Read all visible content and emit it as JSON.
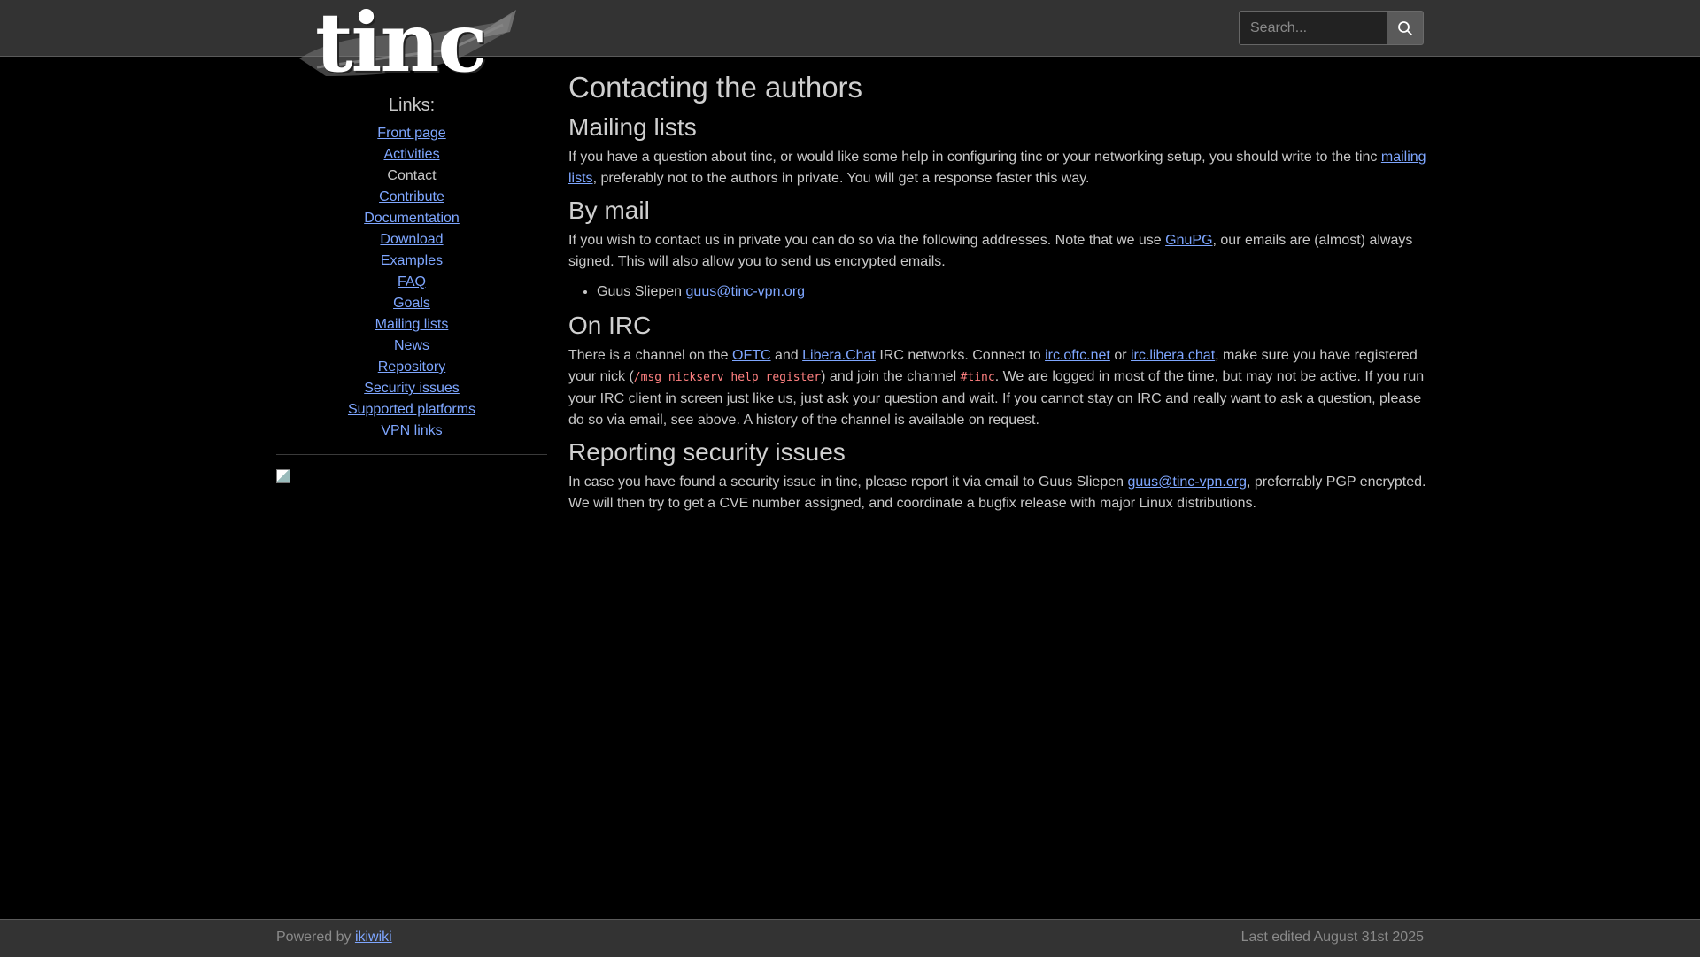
{
  "header": {
    "logo_text": "tinc",
    "search_placeholder": "Search..."
  },
  "sidebar": {
    "heading": "Links:",
    "items": [
      {
        "label": "Front page",
        "link": true
      },
      {
        "label": "Activities",
        "link": true
      },
      {
        "label": "Contact",
        "link": false
      },
      {
        "label": "Contribute",
        "link": true
      },
      {
        "label": "Documentation",
        "link": true
      },
      {
        "label": "Download",
        "link": true
      },
      {
        "label": "Examples",
        "link": true
      },
      {
        "label": "FAQ",
        "link": true
      },
      {
        "label": "Goals",
        "link": true
      },
      {
        "label": "Mailing lists",
        "link": true
      },
      {
        "label": "News",
        "link": true
      },
      {
        "label": "Repository",
        "link": true
      },
      {
        "label": "Security issues",
        "link": true
      },
      {
        "label": "Supported platforms",
        "link": true
      },
      {
        "label": "VPN links",
        "link": true
      }
    ]
  },
  "main": {
    "title": "Contacting the authors",
    "mailing": {
      "heading": "Mailing lists",
      "text1": "If you have a question about tinc, or would like some help in configuring tinc or your networking setup, you should write to the tinc ",
      "link": "mailing lists",
      "text2": ", preferably not to the authors in private. You will get a response faster this way."
    },
    "mail": {
      "heading": "By mail",
      "text1": "If you wish to contact us in private you can do so via the following addresses. Note that we use ",
      "link": "GnuPG",
      "text2": ", our emails are (almost) always signed. This will also allow you to send us encrypted emails.",
      "contact_name": "Guus Sliepen ",
      "contact_email": "guus@tinc-vpn.org"
    },
    "irc": {
      "heading": "On IRC",
      "t1": "There is a channel on the ",
      "l1": "OFTC",
      "t2": " and ",
      "l2": "Libera.Chat",
      "t3": " IRC networks. Connect to ",
      "l3": "irc.oftc.net",
      "t4": " or ",
      "l4": "irc.libera.chat",
      "t5": ", make sure you have registered your nick (",
      "code1": "/msg nickserv help register",
      "t6": ") and join the channel ",
      "code2": "#tinc",
      "t7": ". We are logged in most of the time, but may not be active. If you run your IRC client in screen just like us, just ask your question and wait. If you cannot stay on IRC and really want to ask a question, please do so via email, see above. A history of the channel is available on request."
    },
    "security": {
      "heading": "Reporting security issues",
      "text1": "In case you have found a security issue in tinc, please report it via email to Guus Sliepen ",
      "link": "guus@tinc-vpn.org",
      "text2": ", preferrably PGP encrypted. We will then try to get a CVE number assigned, and coordinate a bugfix release with major Linux distributions."
    }
  },
  "footer": {
    "powered_prefix": "Powered by ",
    "powered_link": "ikiwiki",
    "last_edited": "Last edited August 31st 2025"
  }
}
